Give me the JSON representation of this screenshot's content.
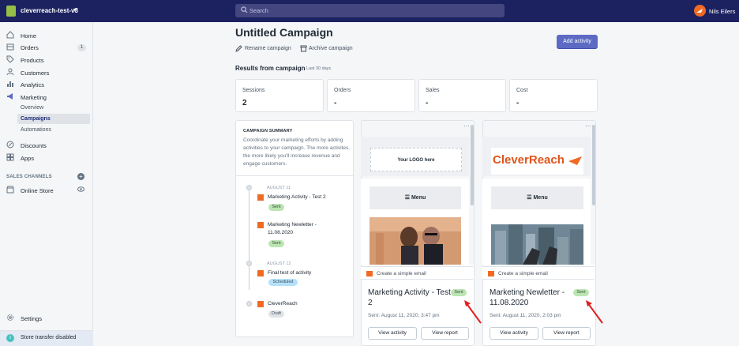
{
  "topbar": {
    "store_name": "cleverreach-test-v3",
    "search_placeholder": "Search",
    "user_name": "Nils Eilers"
  },
  "sidebar": {
    "items": [
      {
        "label": "Home",
        "icon": "home-icon"
      },
      {
        "label": "Orders",
        "icon": "orders-icon",
        "badge": "1"
      },
      {
        "label": "Products",
        "icon": "tag-icon"
      },
      {
        "label": "Customers",
        "icon": "person-icon"
      },
      {
        "label": "Analytics",
        "icon": "bar-chart-icon"
      },
      {
        "label": "Marketing",
        "icon": "megaphone-icon"
      }
    ],
    "marketing_sub": [
      "Overview",
      "Campaigns",
      "Automations"
    ],
    "items2": [
      {
        "label": "Discounts",
        "icon": "discount-icon"
      },
      {
        "label": "Apps",
        "icon": "apps-icon"
      }
    ],
    "sales_channels_heading": "SALES CHANNELS",
    "online_store": "Online Store",
    "settings": "Settings",
    "store_transfer": "Store transfer disabled"
  },
  "page": {
    "breadcrumb_fragment": "",
    "title": "Untitled Campaign",
    "rename": "Rename campaign",
    "archive": "Archive campaign",
    "add_activity": "Add activity",
    "results_heading": "Results from campaign",
    "results_sub": "Last 30 days"
  },
  "stats": [
    {
      "label": "Sessions",
      "value": "2"
    },
    {
      "label": "Orders",
      "value": "-"
    },
    {
      "label": "Sales",
      "value": "-"
    },
    {
      "label": "Cost",
      "value": "-"
    }
  ],
  "summary": {
    "heading": "CAMPAIGN SUMMARY",
    "text": "Coordinate your marketing efforts by adding activities to your campaign. The more activites, the more likely you'll increase revenue and engage customers.",
    "timeline": [
      {
        "date": "AUGUST 11",
        "title": "Marketing Activity - Test 2",
        "status": "Sent"
      },
      {
        "date": "",
        "title": "Marketing Newletter - 11.08.2020",
        "status": "Sent"
      },
      {
        "date": "AUGUST 12",
        "title": "Final test of activity",
        "status": "Scheduled"
      },
      {
        "date": "",
        "title": "CleverReach",
        "status": "Draft"
      }
    ]
  },
  "cards": [
    {
      "logo_text": "Your LOGO here",
      "menu": "☰ Menu",
      "type": "Create a simple email",
      "title": "Marketing Activity - Test 2",
      "status": "Sent",
      "sent": "Sent: August 11, 2020, 3:47 pm",
      "view_activity": "View activity",
      "view_report": "View report"
    },
    {
      "logo_text": "CleverReach",
      "menu": "☰ Menu",
      "type": "Create a simple email",
      "title": "Marketing Newletter - 11.08.2020",
      "status": "Sent",
      "sent": "Sent: August 11, 2020, 2:03 pm",
      "view_activity": "View activity",
      "view_report": "View report"
    }
  ],
  "colors": {
    "topbar": "#1c2260",
    "primary": "#5c6ac4",
    "brand_orange": "#f06a24",
    "annotation_red": "#e02020"
  }
}
